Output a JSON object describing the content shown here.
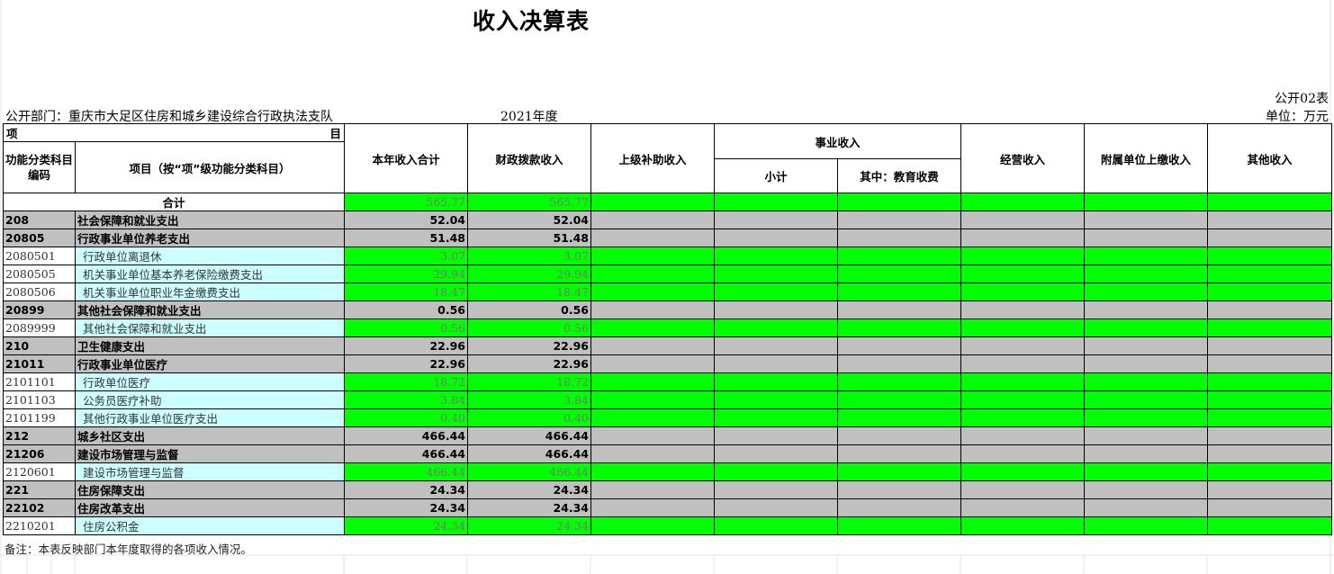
{
  "title": "收入决算表",
  "form_no": "公开02表",
  "department": "公开部门：重庆市大足区住房和城乡建设综合行政执法支队",
  "year": "2021年度",
  "unit": "单位：万元",
  "header": {
    "xiang": "项",
    "mu": "目",
    "code_col": "功能分类科目编码",
    "name_col": "项目（按“项”级功能分类科目）",
    "total_income": "本年收入合计",
    "fiscal": "财政拨款收入",
    "superior": "上级补助收入",
    "business": "事业收入",
    "subtotal": "小计",
    "education": "其中：教育收费",
    "operating": "经营收入",
    "affiliated": "附属单位上缴收入",
    "other": "其他收入"
  },
  "total_row": {
    "label": "合计",
    "total": "565.77",
    "fiscal": "565.77"
  },
  "rows": [
    {
      "level": 1,
      "code": "208",
      "name": "社会保障和就业支出",
      "total": "52.04",
      "fiscal": "52.04"
    },
    {
      "level": 2,
      "code": "20805",
      "name": "行政事业单位养老支出",
      "total": "51.48",
      "fiscal": "51.48"
    },
    {
      "level": 3,
      "code": "2080501",
      "name": "行政单位离退休",
      "total": "3.07",
      "fiscal": "3.07"
    },
    {
      "level": 3,
      "code": "2080505",
      "name": "机关事业单位基本养老保险缴费支出",
      "total": "29.94",
      "fiscal": "29.94"
    },
    {
      "level": 3,
      "code": "2080506",
      "name": "机关事业单位职业年金缴费支出",
      "total": "18.47",
      "fiscal": "18.47"
    },
    {
      "level": 2,
      "code": "20899",
      "name": "其他社会保障和就业支出",
      "total": "0.56",
      "fiscal": "0.56"
    },
    {
      "level": 3,
      "code": "2089999",
      "name": "其他社会保障和就业支出",
      "total": "0.56",
      "fiscal": "0.56"
    },
    {
      "level": 1,
      "code": "210",
      "name": "卫生健康支出",
      "total": "22.96",
      "fiscal": "22.96"
    },
    {
      "level": 2,
      "code": "21011",
      "name": "行政事业单位医疗",
      "total": "22.96",
      "fiscal": "22.96"
    },
    {
      "level": 3,
      "code": "2101101",
      "name": "行政单位医疗",
      "total": "18.72",
      "fiscal": "18.72"
    },
    {
      "level": 3,
      "code": "2101103",
      "name": "公务员医疗补助",
      "total": "3.84",
      "fiscal": "3.84"
    },
    {
      "level": 3,
      "code": "2101199",
      "name": "其他行政事业单位医疗支出",
      "total": "0.40",
      "fiscal": "0.40"
    },
    {
      "level": 1,
      "code": "212",
      "name": "城乡社区支出",
      "total": "466.44",
      "fiscal": "466.44"
    },
    {
      "level": 2,
      "code": "21206",
      "name": "建设市场管理与监督",
      "total": "466.44",
      "fiscal": "466.44"
    },
    {
      "level": 3,
      "code": "2120601",
      "name": "建设市场管理与监督",
      "total": "466.44",
      "fiscal": "466.44"
    },
    {
      "level": 1,
      "code": "221",
      "name": "住房保障支出",
      "total": "24.34",
      "fiscal": "24.34"
    },
    {
      "level": 2,
      "code": "22102",
      "name": "住房改革支出",
      "total": "24.34",
      "fiscal": "24.34"
    },
    {
      "level": 3,
      "code": "2210201",
      "name": "住房公积金",
      "total": "24.34",
      "fiscal": "24.34"
    }
  ],
  "note": "备注：本表反映部门本年度取得的各项收入情况。",
  "colors": {
    "green": "#00ff00",
    "gray": "#c0c0c0",
    "cyan": "#ccffff"
  }
}
